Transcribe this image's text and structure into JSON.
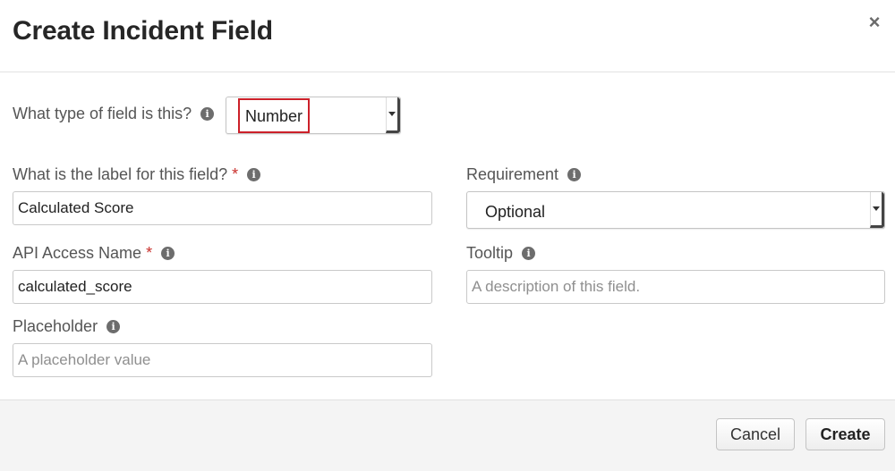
{
  "modal": {
    "title": "Create Incident Field",
    "close_glyph": "×"
  },
  "info_glyph": "i",
  "field_type": {
    "label": "What type of field is this?",
    "value": "Number"
  },
  "field_label": {
    "label": "What is the label for this field?",
    "required_mark": "*",
    "value": "Calculated Score"
  },
  "requirement": {
    "label": "Requirement",
    "value": "Optional"
  },
  "api_name": {
    "label": "API Access Name",
    "required_mark": "*",
    "value": "calculated_score"
  },
  "tooltip": {
    "label": "Tooltip",
    "placeholder": "A description of this field."
  },
  "placeholder_field": {
    "label": "Placeholder",
    "placeholder": "A placeholder value"
  },
  "footer": {
    "cancel_label": "Cancel",
    "create_label": "Create"
  },
  "colors": {
    "highlight": "#cc2029",
    "required": "#c9302c",
    "footer_bg": "#f4f4f4"
  },
  "icons": [
    "close-icon",
    "info-icon",
    "chevron-down-icon"
  ]
}
